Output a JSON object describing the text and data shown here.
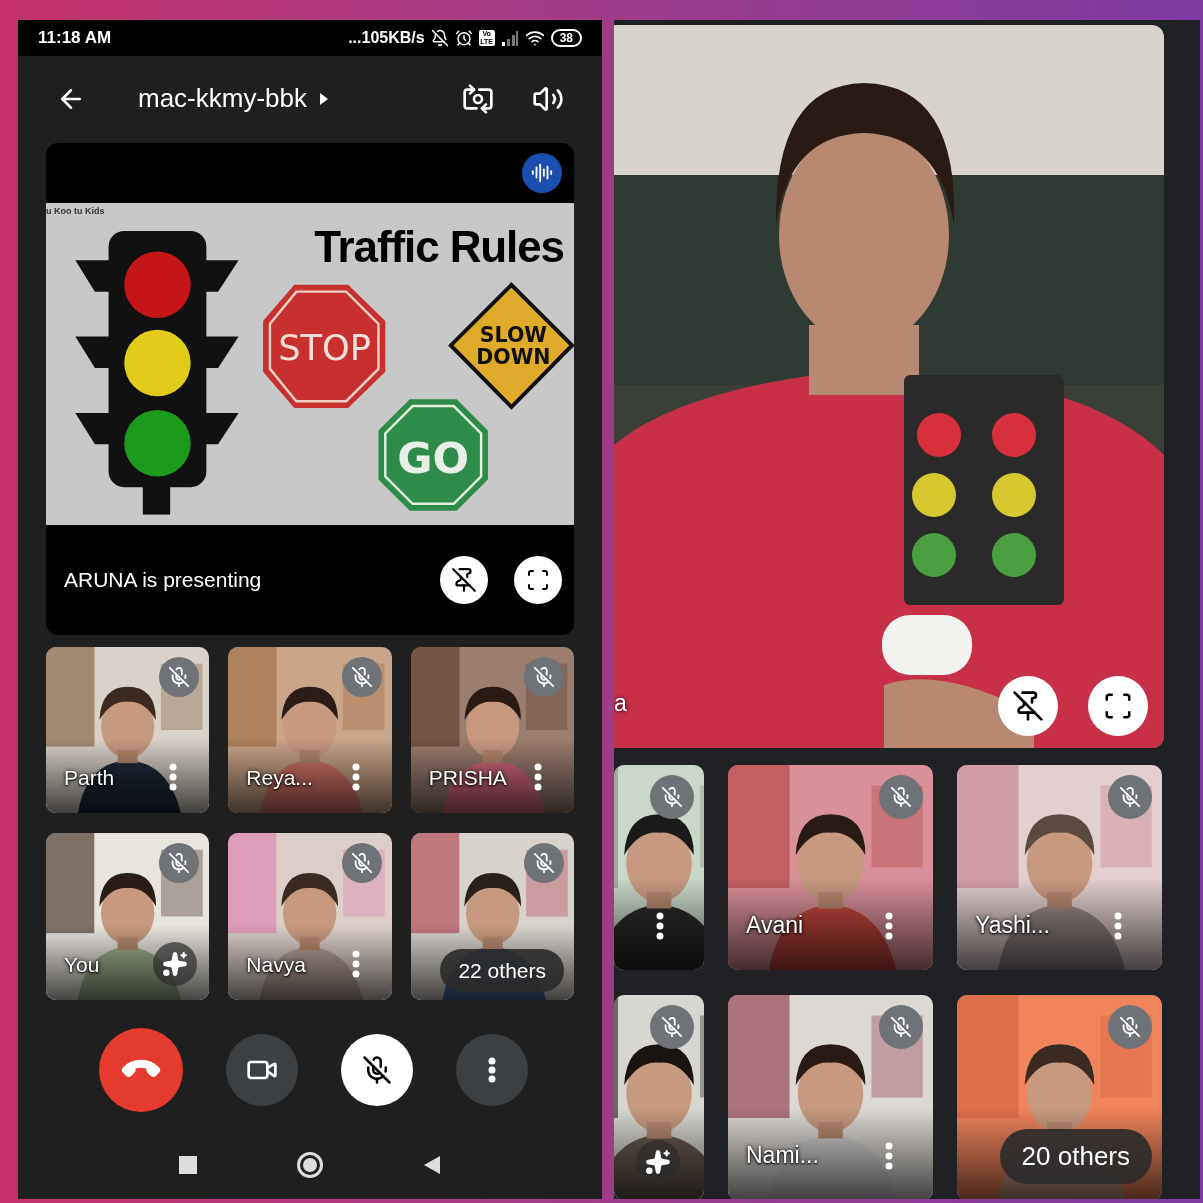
{
  "left_screen": {
    "status_bar": {
      "time": "11:18 AM",
      "network_speed": "...105KB/s",
      "volte": "Vo LTE",
      "battery": "38"
    },
    "app_bar": {
      "meeting_code": "mac-kkmy-bbk"
    },
    "presentation": {
      "speaking": true,
      "slide": {
        "source": "u Koo tu Kids",
        "title": "Traffic Rules",
        "signs": [
          {
            "kind": "stop",
            "text": "STOP"
          },
          {
            "kind": "slow",
            "text": "SLOW DOWN"
          },
          {
            "kind": "go",
            "text": "GO"
          }
        ]
      },
      "presenter_label": "ARUNA is presenting"
    },
    "tiles": [
      {
        "kind": "participant",
        "name": "Parth",
        "muted": true
      },
      {
        "kind": "participant",
        "name": "Reya...",
        "muted": true
      },
      {
        "kind": "participant",
        "name": "PRISHA",
        "muted": true
      },
      {
        "kind": "self",
        "name": "You",
        "muted": true
      },
      {
        "kind": "participant",
        "name": "Navya",
        "muted": true
      },
      {
        "kind": "others",
        "count_label": "22 others",
        "muted": true
      }
    ],
    "controls": [
      {
        "kind": "end_call"
      },
      {
        "kind": "camera"
      },
      {
        "kind": "mic",
        "muted": true
      },
      {
        "kind": "more"
      }
    ]
  },
  "right_screen": {
    "main_tile": {
      "name": "a"
    },
    "tiles": [
      {
        "kind": "participant",
        "muted": true
      },
      {
        "kind": "participant",
        "name": "Avani",
        "muted": true
      },
      {
        "kind": "participant",
        "name": "Yashi...",
        "muted": true
      },
      {
        "kind": "self",
        "muted": true
      },
      {
        "kind": "participant",
        "name": "Nami...",
        "muted": true
      },
      {
        "kind": "others",
        "count_label": "20 others",
        "muted": true
      }
    ]
  }
}
